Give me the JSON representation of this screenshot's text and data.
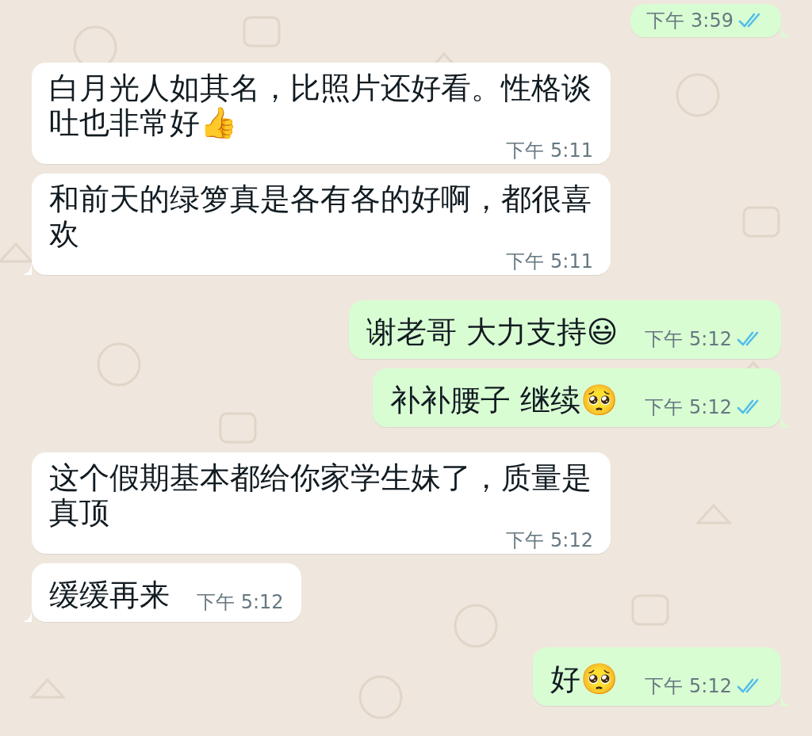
{
  "messages": [
    {
      "kind": "outgoing",
      "time": "下午 3:59",
      "read": true
    },
    {
      "kind": "incoming",
      "text": "白月光人如其名，比照片还好看。性格谈吐也非常好👍",
      "time": "下午 5:11"
    },
    {
      "kind": "incoming",
      "text": "和前天的绿箩真是各有各的好啊，都很喜欢",
      "time": "下午 5:11"
    },
    {
      "kind": "outgoing",
      "text": "谢老哥 大力支持😃",
      "time": "下午 5:12",
      "read": true
    },
    {
      "kind": "outgoing",
      "text": "补补腰子 继续🥺",
      "time": "下午 5:12",
      "read": true
    },
    {
      "kind": "incoming",
      "text": "这个假期基本都给你家学生妹了，质量是真顶",
      "time": "下午 5:12"
    },
    {
      "kind": "incoming",
      "text": "缓缓再来",
      "time": "下午 5:12"
    },
    {
      "kind": "outgoing",
      "text": "好🥺",
      "time": "下午 5:12",
      "read": true
    }
  ]
}
